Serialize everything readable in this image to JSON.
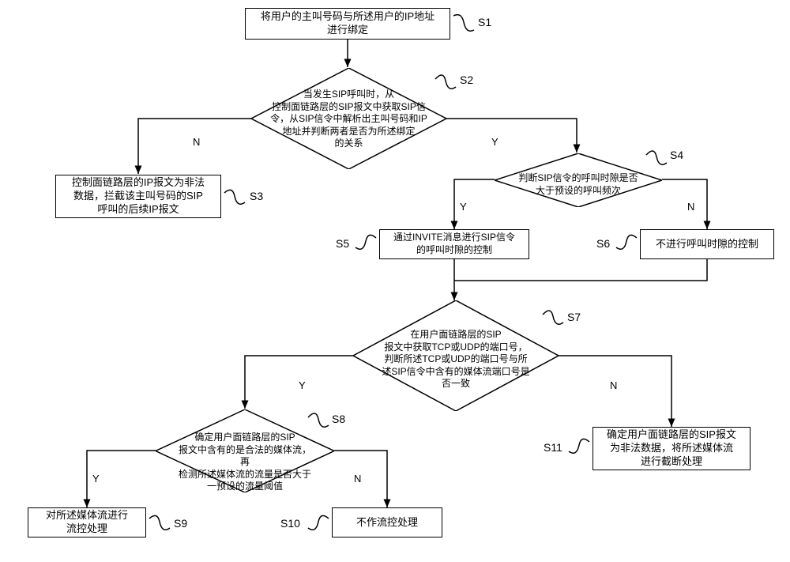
{
  "chart_data": {
    "type": "flowchart",
    "nodes": [
      {
        "id": "S1",
        "type": "process",
        "text": "将用户的主叫号码与所述用户的IP地址进行绑定"
      },
      {
        "id": "S2",
        "type": "decision",
        "text": "当发生SIP呼叫时，从控制面链路层的SIP报文中获取SIP信令，从SIP信令中解析出主叫号码和IP地址并判断两者是否为所述绑定的关系"
      },
      {
        "id": "S3",
        "type": "process",
        "text": "控制面链路层的IP报文为非法数据，拦截该主叫号码的SIP呼叫的后续IP报文"
      },
      {
        "id": "S4",
        "type": "decision",
        "text": "判断SIP信令的呼叫时隙是否大于预设的呼叫频次"
      },
      {
        "id": "S5",
        "type": "process",
        "text": "通过INVITE消息进行SIP信令的呼叫时隙的控制"
      },
      {
        "id": "S6",
        "type": "process",
        "text": "不进行呼叫时隙的控制"
      },
      {
        "id": "S7",
        "type": "decision",
        "text": "在用户面链路层的SIP报文中获取TCP或UDP的端口号，判断所述TCP或UDP的端口号与所述SIP信令中含有的媒体流端口号是否一致"
      },
      {
        "id": "S8",
        "type": "decision",
        "text": "确定用户面链路层的SIP报文中含有的是合法的媒体流，再检测所述媒体流的流量是否大于一预设的流量阈值"
      },
      {
        "id": "S9",
        "type": "process",
        "text": "对所述媒体流进行流控处理"
      },
      {
        "id": "S10",
        "type": "process",
        "text": "不作流控处理"
      },
      {
        "id": "S11",
        "type": "process",
        "text": "确定用户面链路层的SIP报文为非法数据，将所述媒体流进行截断处理"
      }
    ],
    "edges": [
      {
        "from": "S1",
        "to": "S2"
      },
      {
        "from": "S2",
        "to": "S3",
        "label": "N"
      },
      {
        "from": "S2",
        "to": "S4",
        "label": "Y"
      },
      {
        "from": "S4",
        "to": "S5",
        "label": "Y"
      },
      {
        "from": "S4",
        "to": "S6",
        "label": "N"
      },
      {
        "from": "S5",
        "to": "S7"
      },
      {
        "from": "S6",
        "to": "S7"
      },
      {
        "from": "S7",
        "to": "S8",
        "label": "Y"
      },
      {
        "from": "S7",
        "to": "S11",
        "label": "N"
      },
      {
        "from": "S8",
        "to": "S9",
        "label": "Y"
      },
      {
        "from": "S8",
        "to": "S10",
        "label": "N"
      }
    ]
  },
  "nodes": {
    "s1": "将用户的主叫号码与所述用户的IP地址\n进行绑定",
    "s2": "当发生SIP呼叫时，从\n控制面链路层的SIP报文中获取SIP信\n令，从SIP信令中解析出主叫号码和IP\n地址并判断两者是否为所述绑定\n的关系",
    "s3": "控制面链路层的IP报文为非法\n数据，拦截该主叫号码的SIP\n呼叫的后续IP报文",
    "s4": "判断SIP信令的呼叫时隙是否\n大于预设的呼叫频次",
    "s5": "通过INVITE消息进行SIP信令\n的呼叫时隙的控制",
    "s6": "不进行呼叫时隙的控制",
    "s7": "在用户面链路层的SIP\n报文中获取TCP或UDP的端口号，\n判断所述TCP或UDP的端口号与所\n述SIP信令中含有的媒体流端口号是\n否一致",
    "s8": "确定用户面链路层的SIP\n报文中含有的是合法的媒体流，再\n检测所述媒体流的流量是否大于\n一预设的流量阈值",
    "s9": "对所述媒体流进行\n流控处理",
    "s10": "不作流控处理",
    "s11": "确定用户面链路层的SIP报文\n为非法数据，将所述媒体流\n进行截断处理"
  },
  "steps": {
    "s1": "S1",
    "s2": "S2",
    "s3": "S3",
    "s4": "S4",
    "s5": "S5",
    "s6": "S6",
    "s7": "S7",
    "s8": "S8",
    "s9": "S9",
    "s10": "S10",
    "s11": "S11"
  },
  "labels": {
    "yes": "Y",
    "no": "N"
  }
}
